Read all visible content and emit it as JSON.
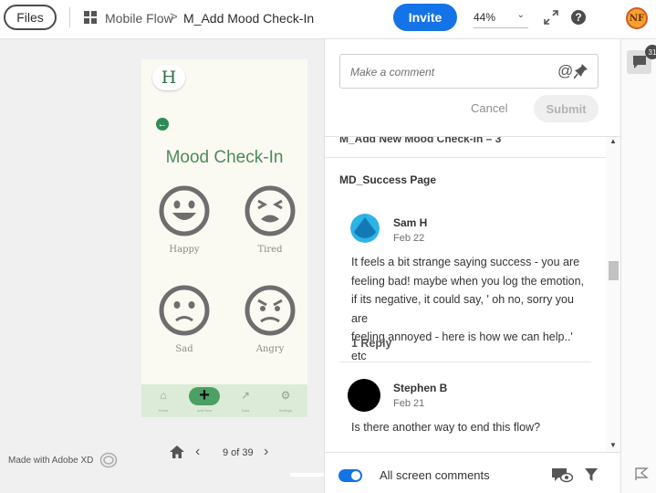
{
  "header": {
    "files_label": "Files",
    "breadcrumb_parent": "Mobile Flow",
    "breadcrumb_separator": ">",
    "breadcrumb_current": "M_Add Mood Check-In",
    "invite_label": "Invite",
    "zoom_value": "44%",
    "help_glyph": "?",
    "avatar_initials": "NF",
    "accent_color": "#1473e6"
  },
  "artboard": {
    "logo_letter": "H",
    "title": "Mood Check-In",
    "moods": [
      {
        "label": "Happy",
        "icon": "happy-face-icon"
      },
      {
        "label": "Tired",
        "icon": "tired-face-icon"
      },
      {
        "label": "Sad",
        "icon": "sad-face-icon"
      },
      {
        "label": "Angry",
        "icon": "angry-face-icon"
      }
    ],
    "nav": [
      {
        "label": "Home",
        "icon": "home-icon"
      },
      {
        "label": "Add New",
        "icon": "plus-icon"
      },
      {
        "label": "Data",
        "icon": "trend-icon"
      },
      {
        "label": "Settings",
        "icon": "gear-icon"
      }
    ],
    "brand_green": "#4d8a5d"
  },
  "canvas_footer": {
    "made_with": "Made with Adobe XD",
    "page_indicator": "9 of 39"
  },
  "comments_panel": {
    "input_placeholder": "Make a comment",
    "at_glyph": "@",
    "cancel_label": "Cancel",
    "submit_label": "Submit",
    "previous_group_title": "M_Add New Mood Check-In – 3",
    "group_title": "MD_Success Page",
    "comments": [
      {
        "author": "Sam H",
        "date": "Feb 22",
        "text_lines": [
          "It feels a bit strange saying success - you are",
          "feeling bad! maybe when you log the emotion,",
          "if its negative, it could say, ' oh no, sorry you are",
          "feeling annoyed - here is how we can help..' etc"
        ],
        "replies": "1 Reply"
      },
      {
        "author": "Stephen B",
        "date": "Feb 21",
        "text_lines": [
          "Is there another way to end this flow?"
        ]
      }
    ],
    "footer_label": "All screen comments"
  },
  "rail": {
    "comment_count": "31"
  }
}
